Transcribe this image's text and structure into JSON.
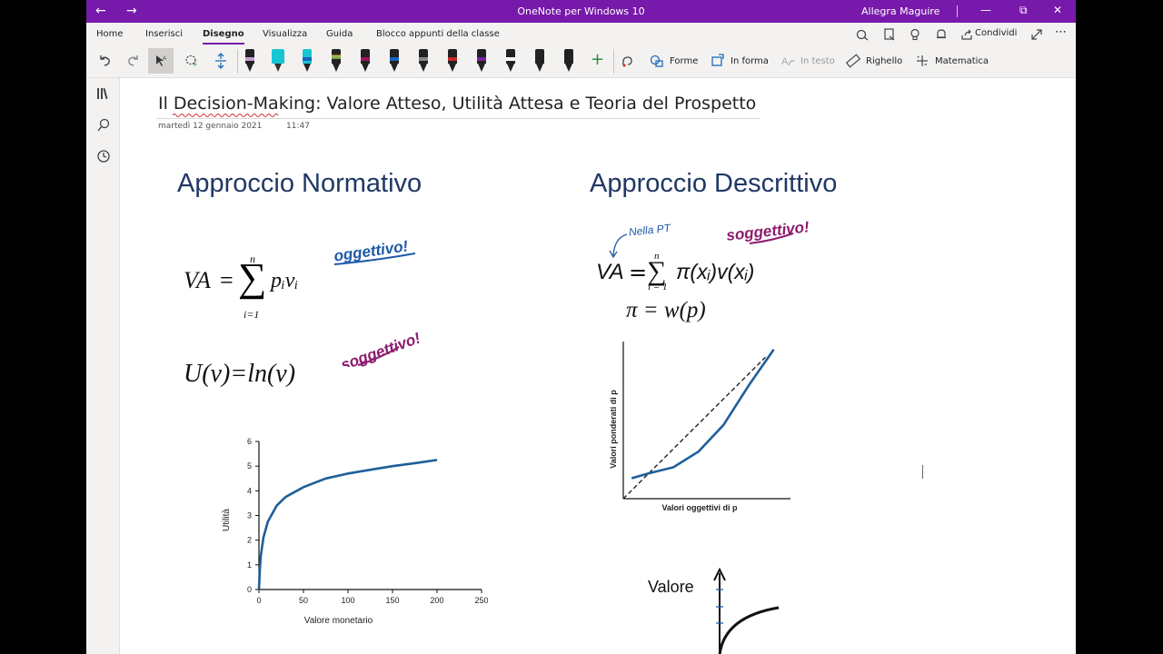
{
  "window": {
    "app_title": "OneNote per Windows 10",
    "user": "Allegra Maguire",
    "back_icon": "←",
    "forward_icon": "→",
    "minimize_icon": "—",
    "restore_icon": "⧉",
    "close_icon": "✕"
  },
  "ribbon": {
    "tabs": [
      "Home",
      "Inserisci",
      "Disegno",
      "Visualizza",
      "Guida",
      "Blocco appunti della classe"
    ],
    "active_tab": "Disegno",
    "share_label": "Condividi",
    "more_icon": "⋯"
  },
  "toolbar": {
    "forme_label": "Forme",
    "in_forma_label": "In forma",
    "in_testo_label": "In testo",
    "righello_label": "Righello",
    "matematica_label": "Matematica",
    "pens": [
      {
        "color": "#222222",
        "band": "#c39bd3"
      },
      {
        "color": "#17c6d3",
        "band": "#17c6d3"
      },
      {
        "color": "#1565c0",
        "band": "#17c6d3"
      },
      {
        "color": "#222222",
        "band": "#e6b34c"
      },
      {
        "color": "#222222",
        "band": "#a0135e"
      },
      {
        "color": "#222222",
        "band": "#1565c0"
      },
      {
        "color": "#222222",
        "band": "#888888"
      },
      {
        "color": "#222222",
        "band": "#c62828"
      },
      {
        "color": "#222222",
        "band": "#7b1fa2"
      },
      {
        "color": "#222222",
        "band": "#ffffff"
      },
      {
        "color": "#222222",
        "band": "#222222"
      },
      {
        "color": "#222222",
        "band": "#222222"
      }
    ]
  },
  "page": {
    "title": "Il Decision-Making: Valore Atteso, Utilità Attesa e Teoria del Prospetto",
    "date": "martedì 12 gennaio 2021",
    "time": "11:47",
    "heading_normative": "Approccio Normativo",
    "heading_descriptive": "Approccio Descrittivo",
    "formula_va_left": "VA",
    "formula_eq": "=",
    "formula_sum": "∑",
    "formula_top_n": "n",
    "formula_bottom": "i=1",
    "formula_term": "pᵢvᵢ",
    "formula_u": "U(v)=ln(v)",
    "formula_pt_bottom": "i = 1",
    "formula_pt_term": "π(xᵢ)v(xᵢ)",
    "formula_pi": "π = w(p)",
    "note_oggettivo": "oggettivo!",
    "note_soggettivo_1": "soggettivo!",
    "note_soggettivo_2": "soggettivo!",
    "note_nella_pt": "Nella PT",
    "valore_label": "Valore",
    "colors": {
      "accent": "#7719aa",
      "heading": "#1f3864",
      "curve": "#1f5f9a",
      "ink_blue": "#1e5aa8",
      "ink_purple": "#8e1b6e"
    }
  },
  "chart_data": [
    {
      "type": "line",
      "title": "",
      "xlabel": "Valore monetario",
      "ylabel": "Utilità",
      "xlim": [
        0,
        250
      ],
      "ylim": [
        0,
        6
      ],
      "xticks": [
        0,
        50,
        100,
        150,
        200,
        250
      ],
      "yticks": [
        0,
        1,
        2,
        3,
        4,
        5,
        6
      ],
      "grid": false,
      "series": [
        {
          "x": [
            0.01,
            1,
            2,
            5,
            10,
            20,
            30,
            50,
            75,
            100,
            125,
            150,
            175,
            200
          ],
          "y": [
            0.0,
            0.8,
            1.35,
            2.1,
            2.75,
            3.4,
            3.75,
            4.15,
            4.5,
            4.7,
            4.85,
            5.0,
            5.12,
            5.25
          ]
        }
      ]
    },
    {
      "type": "line",
      "title": "",
      "xlabel": "Valori oggettivi di p",
      "ylabel": "Valori ponderati di p",
      "xlim": [
        0,
        1
      ],
      "ylim": [
        0,
        1
      ],
      "grid": false,
      "series": [
        {
          "x": [
            0.05,
            0.15,
            0.3,
            0.45,
            0.6,
            0.75,
            0.9
          ],
          "y": [
            0.13,
            0.16,
            0.2,
            0.3,
            0.47,
            0.72,
            0.95
          ]
        },
        {
          "x": [
            0,
            0.85
          ],
          "y": [
            0,
            0.9
          ]
        }
      ]
    }
  ]
}
